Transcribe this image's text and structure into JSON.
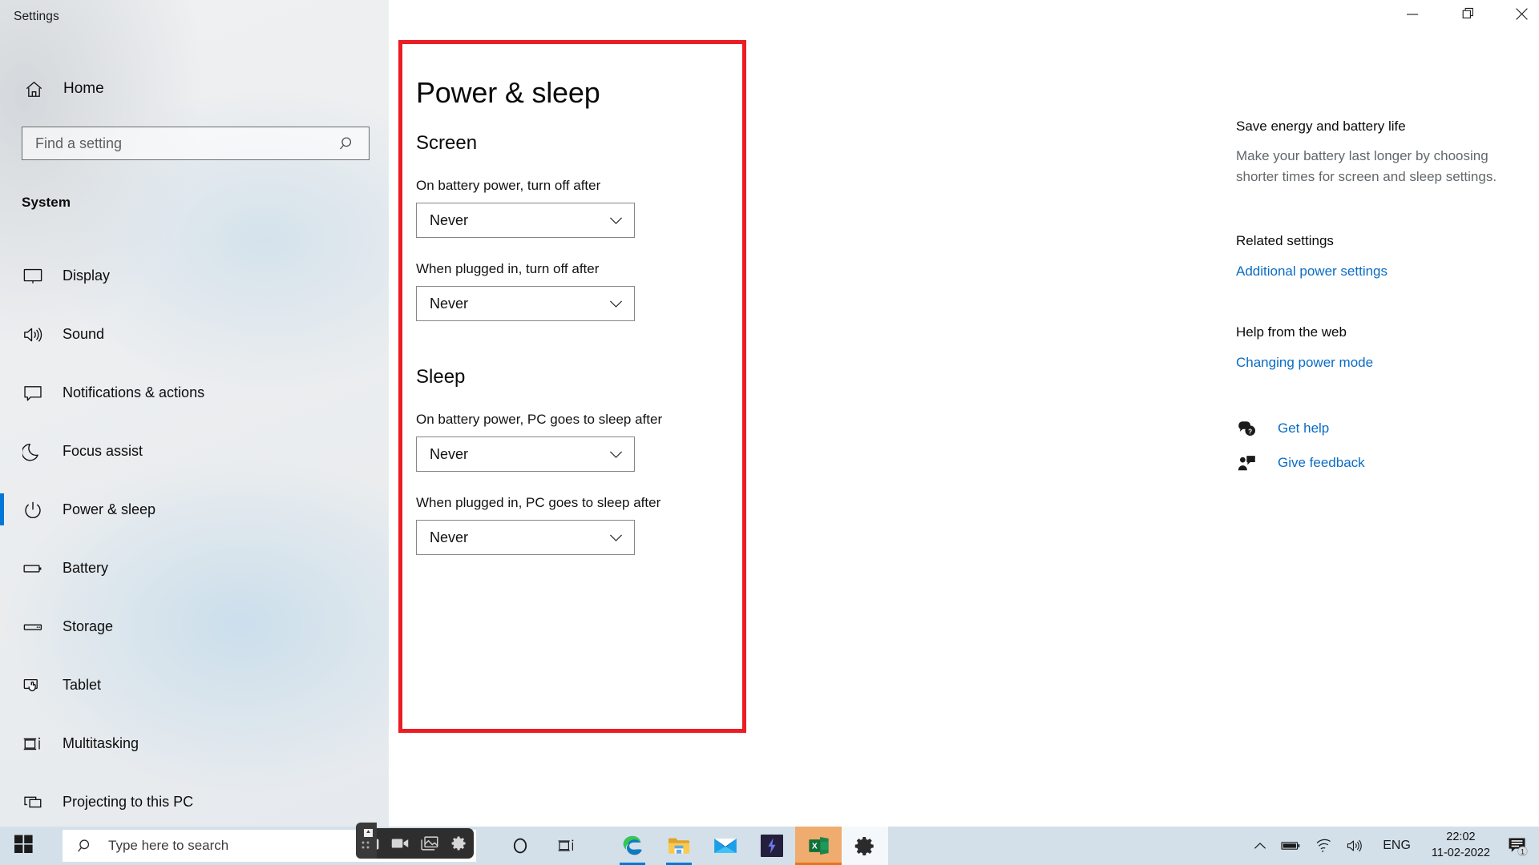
{
  "window": {
    "title": "Settings",
    "controls": {
      "minimize": "minimize-icon",
      "restore": "restore-icon",
      "close": "close-icon"
    }
  },
  "sidebar": {
    "home_label": "Home",
    "home_icon": "home-icon",
    "search": {
      "placeholder": "Find a setting",
      "icon": "search-icon"
    },
    "section_heading": "System",
    "items": [
      {
        "label": "Display",
        "icon": "monitor-icon",
        "selected": false
      },
      {
        "label": "Sound",
        "icon": "speaker-icon",
        "selected": false
      },
      {
        "label": "Notifications & actions",
        "icon": "notification-icon",
        "selected": false
      },
      {
        "label": "Focus assist",
        "icon": "moon-icon",
        "selected": false
      },
      {
        "label": "Power & sleep",
        "icon": "power-icon",
        "selected": true
      },
      {
        "label": "Battery",
        "icon": "battery-icon",
        "selected": false
      },
      {
        "label": "Storage",
        "icon": "storage-icon",
        "selected": false
      },
      {
        "label": "Tablet",
        "icon": "tablet-icon",
        "selected": false
      },
      {
        "label": "Multitasking",
        "icon": "multitasking-icon",
        "selected": false
      },
      {
        "label": "Projecting to this PC",
        "icon": "projecting-icon",
        "selected": false
      }
    ],
    "accent_color": "#0078d7"
  },
  "main": {
    "page_title": "Power & sleep",
    "sections": [
      {
        "heading": "Screen",
        "fields": [
          {
            "label": "On battery power, turn off after",
            "value": "Never"
          },
          {
            "label": "When plugged in, turn off after",
            "value": "Never"
          }
        ]
      },
      {
        "heading": "Sleep",
        "fields": [
          {
            "label": "On battery power, PC goes to sleep after",
            "value": "Never"
          },
          {
            "label": "When plugged in, PC goes to sleep after",
            "value": "Never"
          }
        ]
      }
    ],
    "annotation_color": "#ec1c24"
  },
  "right_pane": {
    "tip_title": "Save energy and battery life",
    "tip_body": "Make your battery last longer by choosing shorter times for screen and sleep settings.",
    "related_title": "Related settings",
    "related_link": "Additional power settings",
    "help_title": "Help from the web",
    "help_link": "Changing power mode",
    "get_help_label": "Get help",
    "get_help_icon": "help-chat-icon",
    "give_feedback_label": "Give feedback",
    "give_feedback_icon": "feedback-person-icon",
    "link_color": "#0a6cc4"
  },
  "taskbar": {
    "start_icon": "windows-start-icon",
    "search_placeholder": "Type here to search",
    "search_icon": "search-icon",
    "items": [
      {
        "name": "cortana-icon",
        "label": "Cortana"
      },
      {
        "name": "task-view-icon",
        "label": "Task View"
      },
      {
        "name": "microsoft-edge-icon",
        "label": "Microsoft Edge"
      },
      {
        "name": "file-explorer-icon",
        "label": "File Explorer"
      },
      {
        "name": "mail-icon",
        "label": "Mail"
      },
      {
        "name": "purple-app-icon",
        "label": "App"
      },
      {
        "name": "excel-icon",
        "label": "Excel"
      },
      {
        "name": "settings-gear-icon",
        "label": "Settings"
      }
    ],
    "tray": {
      "chevron": "chevron-up-icon",
      "battery": "battery-icon",
      "network": "wifi-icon",
      "volume": "volume-icon",
      "language": "ENG",
      "time": "22:02",
      "date": "11-02-2022",
      "notification_icon": "notification-icon",
      "notification_count": "1"
    }
  },
  "recorder": {
    "buttons": [
      "camera-icon",
      "video-icon",
      "gallery-icon",
      "settings-icon"
    ]
  }
}
